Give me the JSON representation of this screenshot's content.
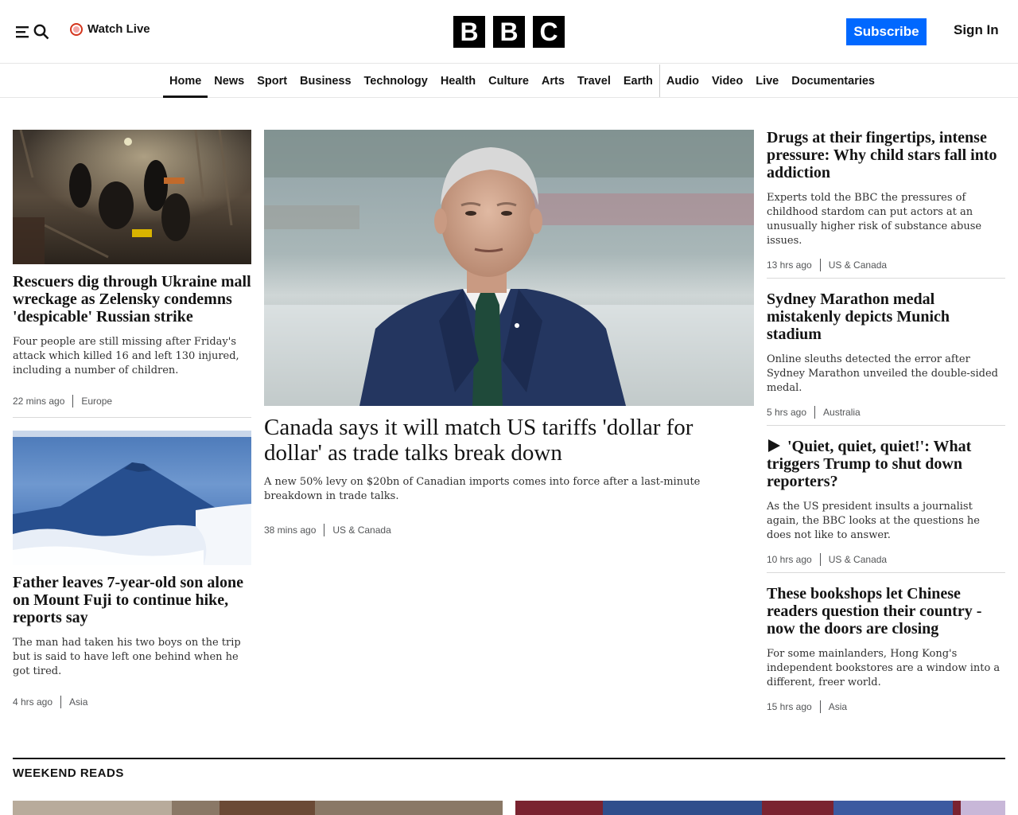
{
  "header": {
    "watch_live": "Watch Live",
    "logo_letters": [
      "B",
      "B",
      "C"
    ],
    "subscribe": "Subscribe",
    "sign_in": "Sign In",
    "accent_color": "#0068ff"
  },
  "nav": {
    "items": [
      {
        "label": "Home",
        "active": true
      },
      {
        "label": "News"
      },
      {
        "label": "Sport"
      },
      {
        "label": "Business"
      },
      {
        "label": "Technology"
      },
      {
        "label": "Health"
      },
      {
        "label": "Culture"
      },
      {
        "label": "Arts"
      },
      {
        "label": "Travel"
      },
      {
        "label": "Earth"
      },
      {
        "label": "Audio"
      },
      {
        "label": "Video"
      },
      {
        "label": "Live"
      },
      {
        "label": "Documentaries"
      }
    ]
  },
  "left": [
    {
      "headline": "Rescuers dig through Ukraine mall wreckage as Zelensky condemns 'despicable' Russian strike",
      "summary": "Four people are still missing after Friday's attack which killed 16 and left 130 injured, including a number of children.",
      "time": "22 mins ago",
      "tag": "Europe"
    },
    {
      "headline": "Father leaves 7-year-old son alone on Mount Fuji to continue hike, reports say",
      "summary": "The man had taken his two boys on the trip but is said to have left one behind when he got tired.",
      "time": "4 hrs ago",
      "tag": "Asia"
    }
  ],
  "main": {
    "headline": "Canada says it will match US tariffs 'dollar for dollar' as trade talks break down",
    "summary": "A new 50% levy on $20bn of Canadian imports comes into force after a last-minute breakdown in trade talks.",
    "time": "38 mins ago",
    "tag": "US & Canada"
  },
  "right": [
    {
      "headline": "Drugs at their fingertips, intense pressure: Why child stars fall into addiction",
      "summary": "Experts told the BBC the pressures of childhood stardom can put actors at an unusually higher risk of substance abuse issues.",
      "time": "13 hrs ago",
      "tag": "US & Canada"
    },
    {
      "headline": "Sydney Marathon medal mistakenly depicts Munich stadium",
      "summary": "Online sleuths detected the error after Sydney Marathon unveiled the double-sided medal.",
      "time": "5 hrs ago",
      "tag": "Australia"
    },
    {
      "headline": "'Quiet, quiet, quiet!': What triggers Trump to shut down reporters?",
      "summary": "As the US president insults a journalist again, the BBC looks at the questions he does not like to answer.",
      "time": "10 hrs ago",
      "tag": "US & Canada",
      "icon": "play-icon"
    },
    {
      "headline": "These bookshops let Chinese readers question their country - now the doors are closing",
      "summary": "For some mainlanders, Hong Kong's independent bookstores are a window into a different, freer world.",
      "time": "15 hrs ago",
      "tag": "Asia"
    }
  ],
  "section": {
    "title": "WEEKEND READS"
  }
}
